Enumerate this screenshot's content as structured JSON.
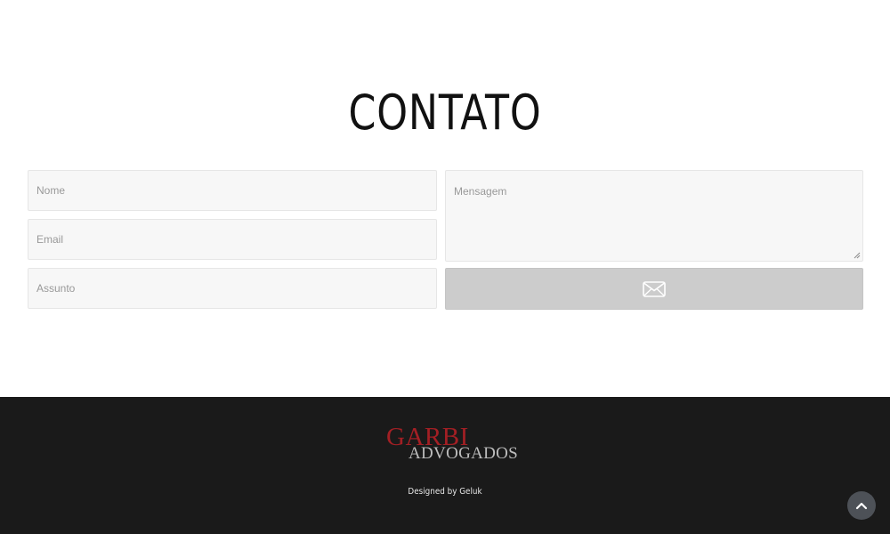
{
  "contact": {
    "title": "CONTATO",
    "form": {
      "name_placeholder": "Nome",
      "email_placeholder": "Email",
      "subject_placeholder": "Assunto",
      "message_placeholder": "Mensagem",
      "send_icon": "envelope-icon"
    }
  },
  "footer": {
    "logo": {
      "line1": "GARBI",
      "line2": "ADVOGADOS"
    },
    "credit": "Designed by Geluk",
    "scroll_top_icon": "chevron-up-icon"
  },
  "colors": {
    "footer_background": "#1a1a1a",
    "logo_red": "#a31f24",
    "button_gray": "#cccccc"
  }
}
